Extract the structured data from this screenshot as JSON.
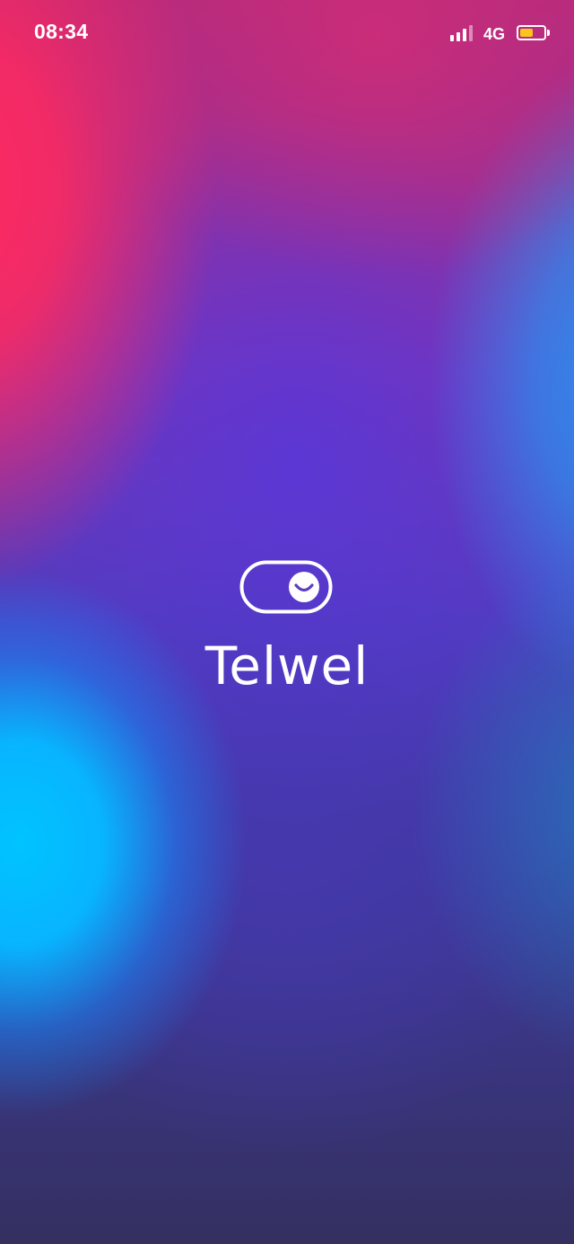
{
  "status_bar": {
    "time": "08:34",
    "network": "4G",
    "signal_bars": 4,
    "signal_strength_bars": 3,
    "battery_level": 0.55,
    "battery_color": "#f8c51c"
  },
  "splash": {
    "brand_name": "Telwel",
    "logo_icon": "toggle-smile-icon",
    "text_color": "#ffffff"
  },
  "background": {
    "colors": [
      "#ff2a5f",
      "#7a34b6",
      "#2a8ff0",
      "#00c4ff",
      "#343060"
    ]
  }
}
